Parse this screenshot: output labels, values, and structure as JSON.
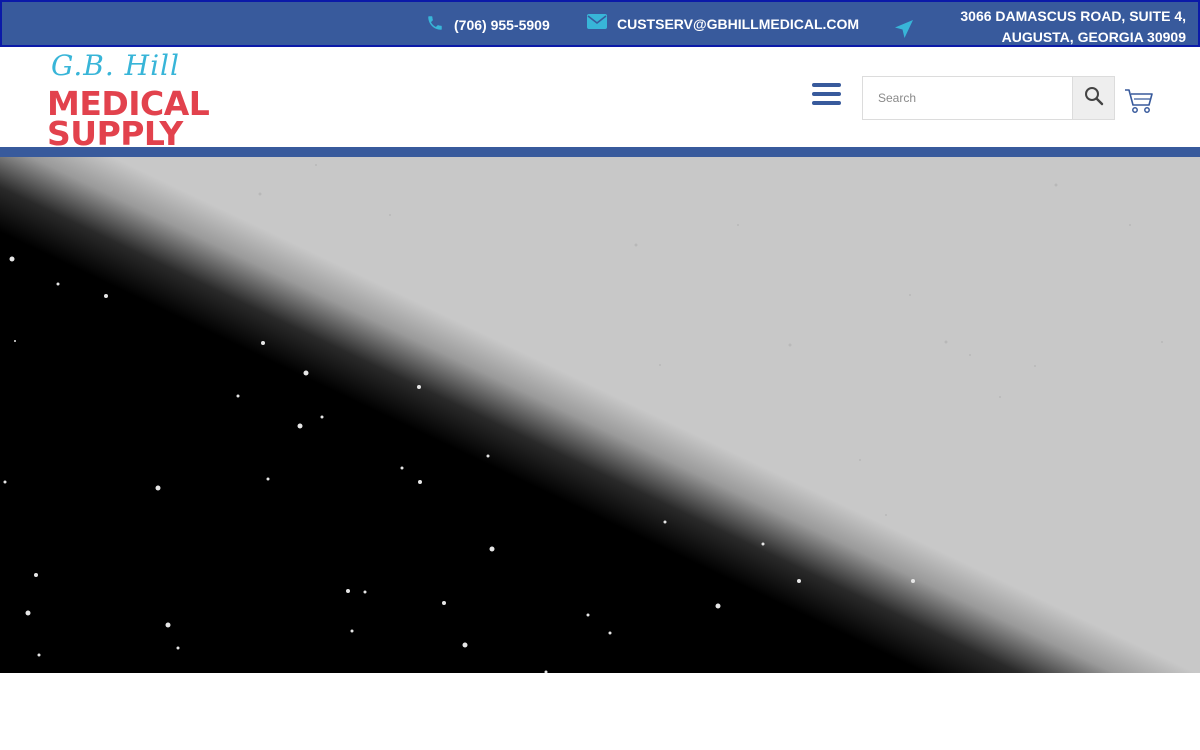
{
  "topbar": {
    "phone": "(706) 955-5909",
    "email": "CUSTSERV@GBHILLMEDICAL.COM",
    "address_line1": "3066 DAMASCUS ROAD, SUITE 4,",
    "address_line2": "AUGUSTA, GEORGIA 30909",
    "icons": [
      "phone-icon",
      "envelope-icon",
      "location-arrow-icon"
    ]
  },
  "logo": {
    "script": "G.B. Hill",
    "line1": "MEDICAL",
    "line2": "SUPPLY"
  },
  "search": {
    "placeholder": "Search"
  },
  "colors": {
    "brand_blue": "#385a9c",
    "brand_red": "#e2424d",
    "accent_cyan": "#38b5d8",
    "hero_light": "#c8c8c8",
    "hero_dark": "#000000"
  }
}
